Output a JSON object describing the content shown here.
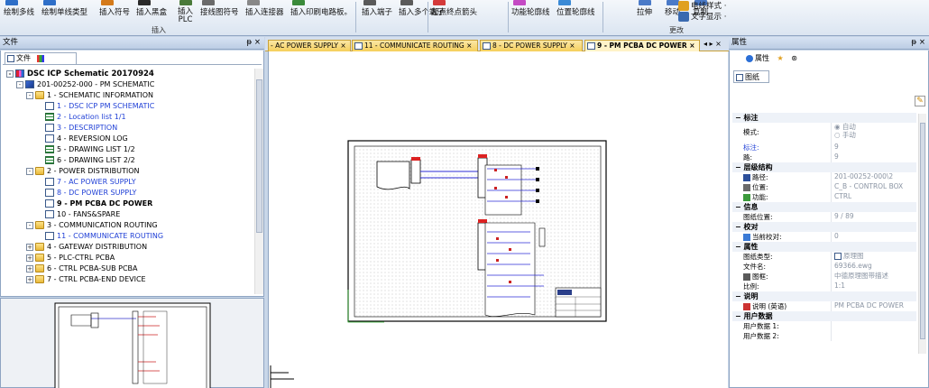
{
  "ribbon": {
    "buttons": [
      {
        "label": "绘制多线"
      },
      {
        "label": "绘制单线类型"
      },
      {
        "label": "插入符号"
      },
      {
        "label": "插入黑盒"
      },
      {
        "label": "插入\nPLC"
      },
      {
        "label": "接线图符号"
      },
      {
        "label": "插入连接器"
      },
      {
        "label": "插入印刷电路板。"
      },
      {
        "label": "插入端子"
      },
      {
        "label": "插入多个端子"
      },
      {
        "label": "起点终点箭头"
      },
      {
        "label": "功能轮廓线"
      },
      {
        "label": "位置轮廓线"
      },
      {
        "label": "拉伸"
      },
      {
        "label": "移动"
      },
      {
        "label": "复制"
      }
    ],
    "right_items": [
      "电线样式 ·",
      "文字显示 ·"
    ],
    "group_insert": "插入",
    "group_change": "更改"
  },
  "left_panel": {
    "title": "文件",
    "pin": "ᵽ ×",
    "tab_label": "文件"
  },
  "tree": [
    {
      "label": "DSC ICP Schematic 20170924",
      "bold": true,
      "level": 0,
      "pm": "-",
      "icon": "book"
    },
    {
      "label": "201-00252-000 - PM SCHEMATIC",
      "level": 1,
      "pm": "-",
      "icon": "book2"
    },
    {
      "label": "1 - SCHEMATIC INFORMATION",
      "level": 2,
      "pm": "-",
      "icon": "folder"
    },
    {
      "label": "1 - DSC ICP PM SCHEMATIC",
      "level": 3,
      "icon": "page",
      "blue": true
    },
    {
      "label": "2 - Location list 1/1",
      "level": 3,
      "icon": "list",
      "blue": true
    },
    {
      "label": "3 - DESCRIPTION",
      "level": 3,
      "icon": "page",
      "blue": true
    },
    {
      "label": "4 - REVERSION LOG",
      "level": 3,
      "icon": "page"
    },
    {
      "label": "5 - DRAWING LIST 1/2",
      "level": 3,
      "icon": "list"
    },
    {
      "label": "6 - DRAWING LIST 2/2",
      "level": 3,
      "icon": "list"
    },
    {
      "label": "2 - POWER DISTRIBUTION",
      "level": 2,
      "pm": "-",
      "icon": "folder"
    },
    {
      "label": "7 - AC POWER SUPPLY",
      "level": 3,
      "icon": "page",
      "blue": true
    },
    {
      "label": "8 - DC POWER SUPPLY",
      "level": 3,
      "icon": "page",
      "blue": true
    },
    {
      "label": "9 - PM PCBA DC POWER",
      "level": 3,
      "icon": "page",
      "bold": true
    },
    {
      "label": "10 - FANS&SPARE",
      "level": 3,
      "icon": "page"
    },
    {
      "label": "3 - COMMUNICATION ROUTING",
      "level": 2,
      "pm": "-",
      "icon": "folder"
    },
    {
      "label": "11 - COMMUNICATE ROUTING",
      "level": 3,
      "icon": "page",
      "blue": true
    },
    {
      "label": "4 - GATEWAY DISTRIBUTION",
      "level": 2,
      "pm": "+",
      "icon": "folder"
    },
    {
      "label": "5 - PLC-CTRL PCBA",
      "level": 2,
      "pm": "+",
      "icon": "folder"
    },
    {
      "label": "6 - CTRL PCBA-SUB PCBA",
      "level": 2,
      "pm": "+",
      "icon": "folder"
    },
    {
      "label": "7 - CTRL PCBA-END DEVICE",
      "level": 2,
      "pm": "+",
      "icon": "folder"
    }
  ],
  "doc_tabs": [
    {
      "label": "- AC POWER SUPPLY ×",
      "active": false
    },
    {
      "label": "11 - COMMUNICATE ROUTING ×",
      "active": false
    },
    {
      "label": "8 - DC POWER SUPPLY ×",
      "active": false
    },
    {
      "label": "9 - PM PCBA DC POWER ×",
      "active": true
    }
  ],
  "tab_nav": "◂ ▸ ×",
  "right_panel": {
    "title": "属性",
    "pin": "ᵽ ×",
    "tab_label": "属性",
    "sub_tab": "图纸"
  },
  "properties": [
    {
      "type": "sec",
      "label": "标注"
    },
    {
      "type": "row",
      "k": "模式:",
      "v": "◉ 自动\n○ 手动",
      "tall": true
    },
    {
      "type": "row",
      "k": "标注:",
      "v": "9",
      "kblue": true
    },
    {
      "type": "row",
      "k": "路:",
      "v": "9"
    },
    {
      "type": "sec",
      "label": "层级结构"
    },
    {
      "type": "row",
      "k": "路径:",
      "v": "201-00252-000\\2",
      "icon": "#2b4f9a"
    },
    {
      "type": "row",
      "k": "位置:",
      "v": "C_B - CONTROL BOX",
      "icon": "#6a6a6a"
    },
    {
      "type": "row",
      "k": "功能:",
      "v": "CTRL",
      "icon": "#3c9a3c"
    },
    {
      "type": "sec",
      "label": "信息"
    },
    {
      "type": "row",
      "k": "图纸位置:",
      "v": "9 / 89"
    },
    {
      "type": "sec",
      "label": "校对"
    },
    {
      "type": "row",
      "k": "当前校对:",
      "v": "0",
      "icon": "#3a7ad6"
    },
    {
      "type": "sec",
      "label": "属性"
    },
    {
      "type": "row",
      "k": "图纸类型:",
      "v": "原理图",
      "vicon": "#3b5a8a"
    },
    {
      "type": "row",
      "k": "文件名:",
      "v": "69366.ewg"
    },
    {
      "type": "row",
      "k": "图框:",
      "v": "中德原理图带描述",
      "icon": "#5a5a5a"
    },
    {
      "type": "row",
      "k": "比例:",
      "v": "1:1"
    },
    {
      "type": "sec",
      "label": "说明"
    },
    {
      "type": "row",
      "k": "说明 (英语)",
      "v": "PM PCBA DC POWER",
      "icon": "#c33"
    },
    {
      "type": "sec",
      "label": "用户数据"
    },
    {
      "type": "row",
      "k": "用户数据 1:",
      "v": ""
    },
    {
      "type": "row",
      "k": "用户数据 2:",
      "v": ""
    }
  ]
}
